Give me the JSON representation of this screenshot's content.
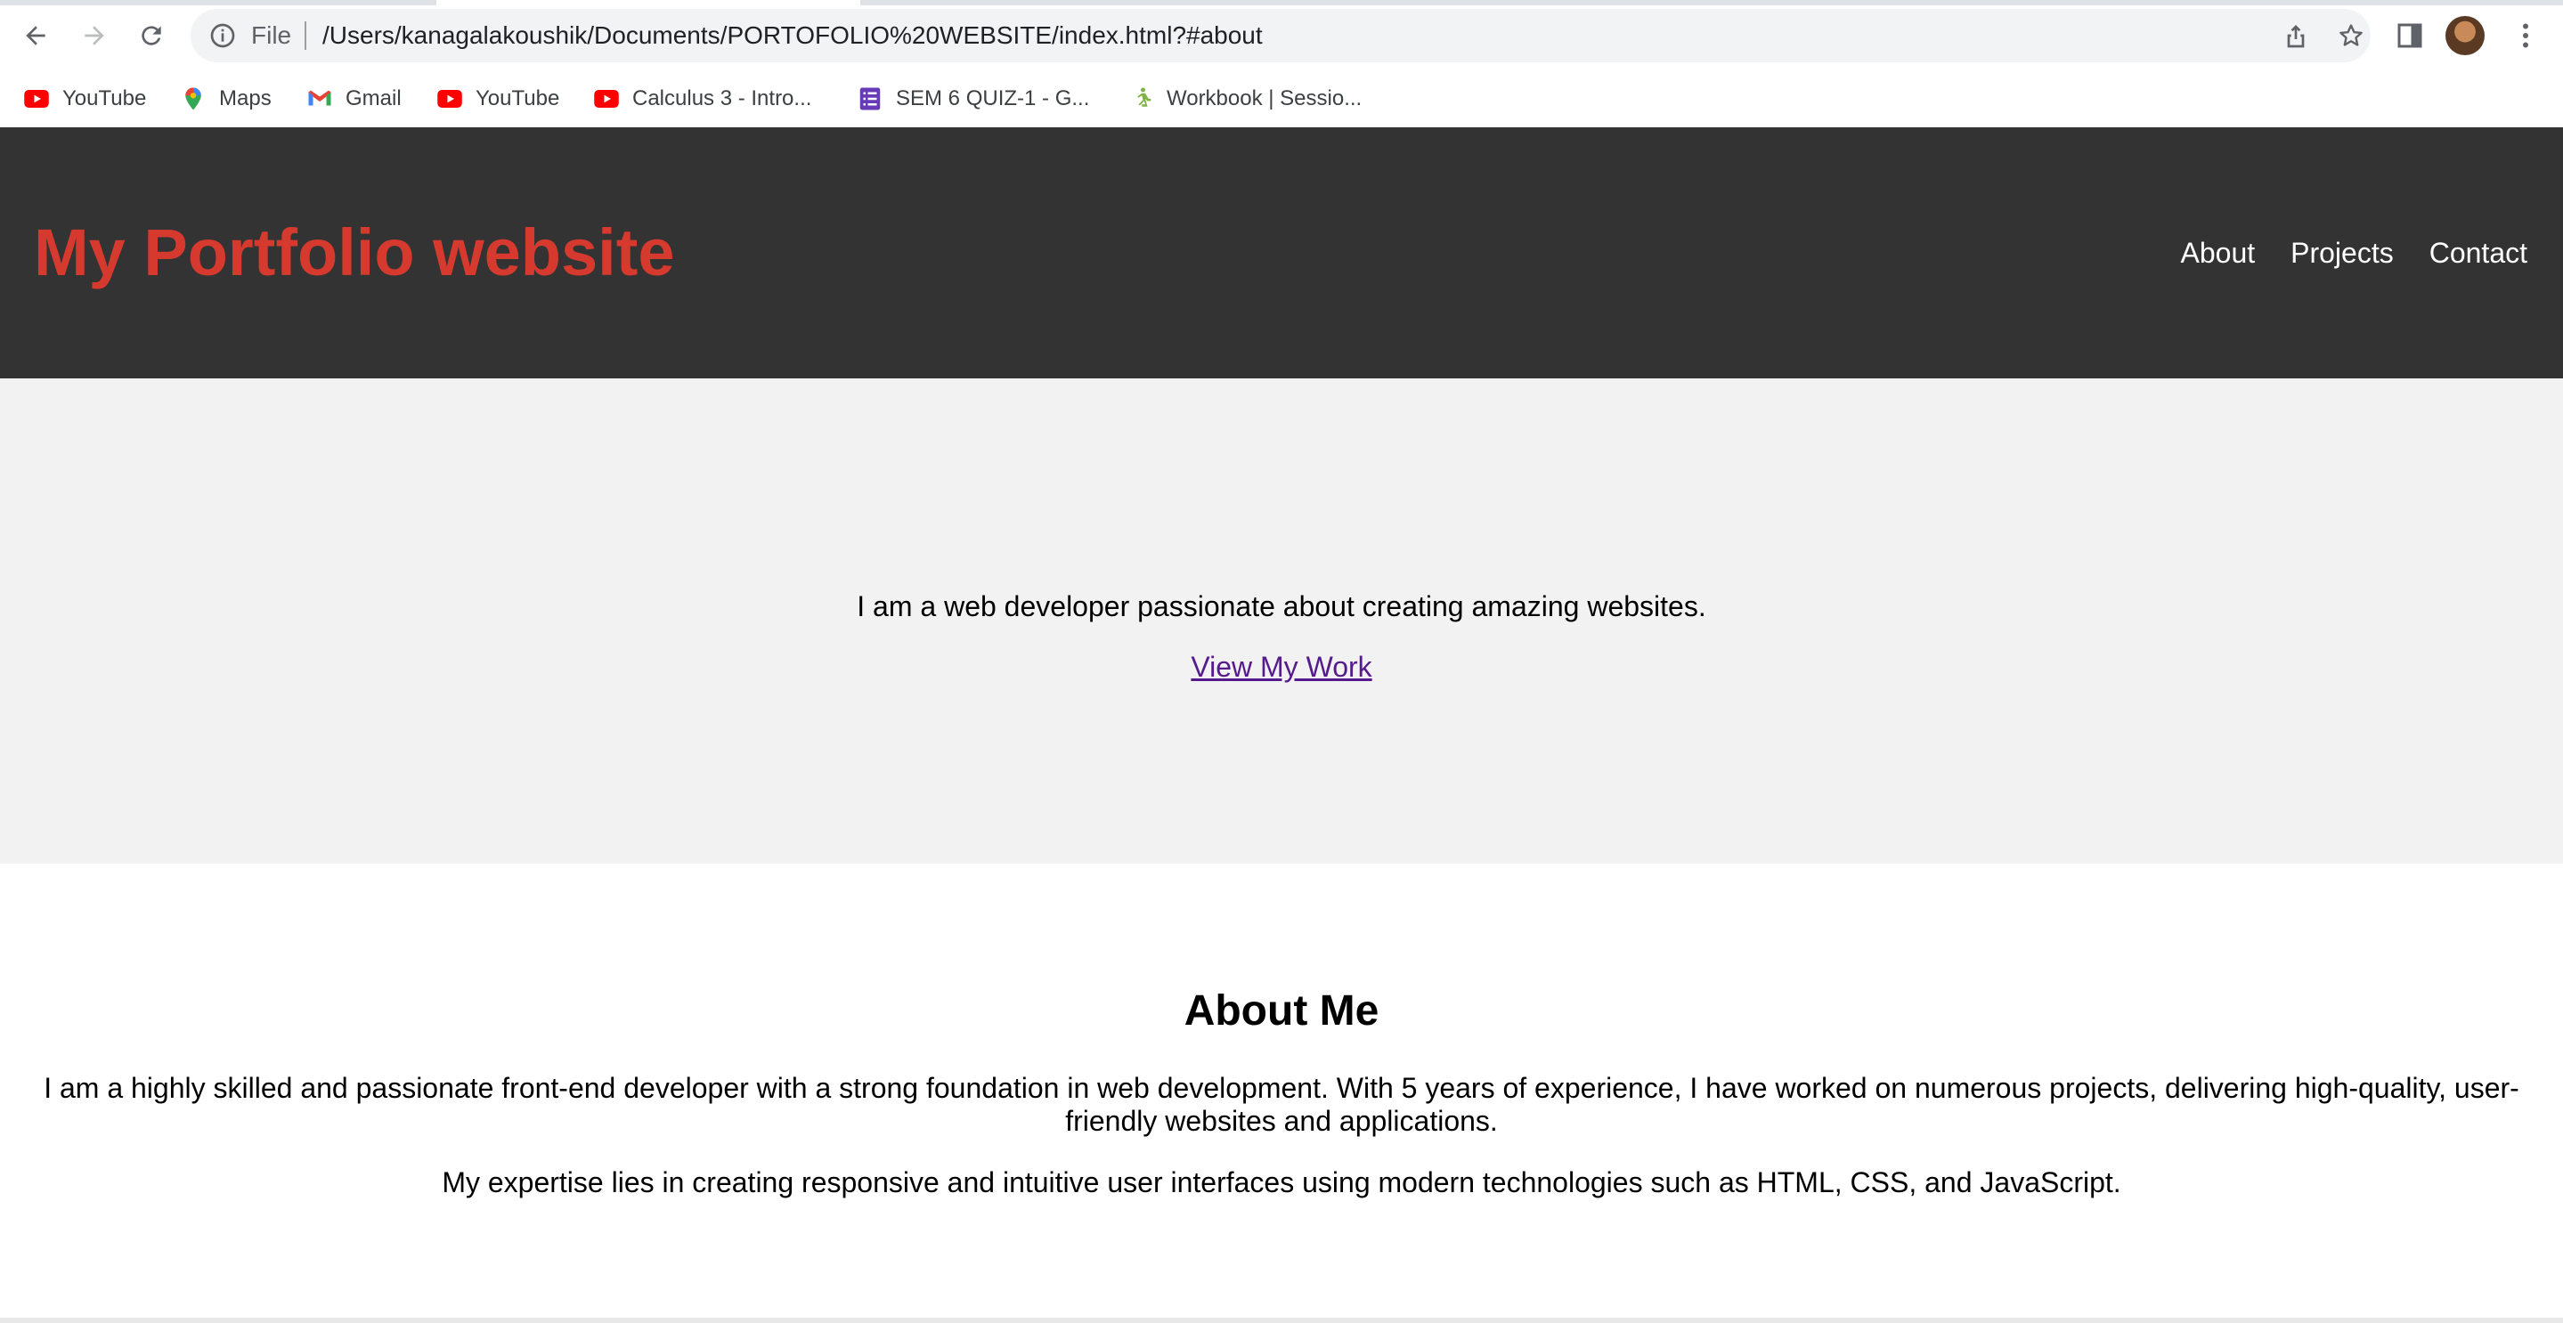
{
  "browser": {
    "omnibox": {
      "scheme_label": "File",
      "url": "/Users/kanagalakoushik/Documents/PORTOFOLIO%20WEBSITE/index.html?#about"
    },
    "bookmarks": [
      {
        "label": "YouTube",
        "icon": "youtube-icon",
        "color": "#ff0000"
      },
      {
        "label": "Maps",
        "icon": "maps-icon",
        "color": "#34a853"
      },
      {
        "label": "Gmail",
        "icon": "gmail-icon",
        "color": "#ea4335"
      },
      {
        "label": "YouTube",
        "icon": "youtube-icon",
        "color": "#ff0000"
      },
      {
        "label": "Calculus 3 - Intro...",
        "icon": "youtube-icon",
        "color": "#ff0000"
      },
      {
        "label": "SEM 6 QUIZ-1 - G...",
        "icon": "forms-icon",
        "color": "#673ab7"
      },
      {
        "label": "Workbook | Sessio...",
        "icon": "runner-icon",
        "color": "#7cb342"
      }
    ]
  },
  "site": {
    "title": "My Portfolio website",
    "title_color": "#d63a2e",
    "header_bg": "#333333",
    "nav": [
      "About",
      "Projects",
      "Contact"
    ],
    "hero": {
      "text": "I am a web developer passionate about creating amazing websites.",
      "link": "View My Work"
    },
    "about": {
      "heading": "About Me",
      "paragraph1": "I am a highly skilled and passionate front-end developer with a strong foundation in web development. With 5 years of experience, I have worked on numerous projects, delivering high-quality, user-friendly websites and applications.",
      "paragraph2": "My expertise lies in creating responsive and intuitive user interfaces using modern technologies such as HTML, CSS, and JavaScript."
    }
  }
}
